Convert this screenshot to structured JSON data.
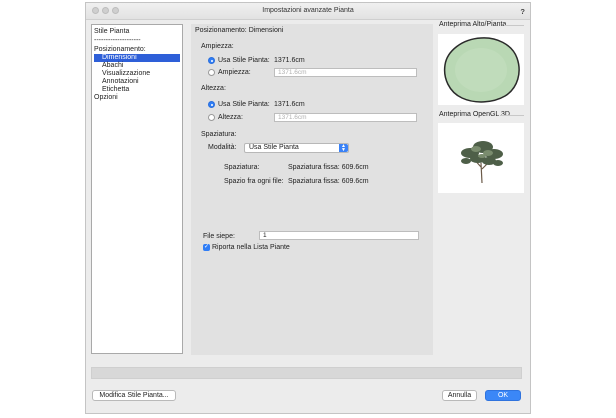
{
  "window": {
    "title": "Impostazioni avanzate Pianta",
    "help": "?"
  },
  "nav": {
    "items": [
      {
        "label": "Stile Pianta"
      },
      {
        "label": "--------------------"
      },
      {
        "label": "Posizionamento:"
      },
      {
        "label": "Dimensioni",
        "selected": true
      },
      {
        "label": "Abachi"
      },
      {
        "label": "Visualizzazione"
      },
      {
        "label": "Annotazioni"
      },
      {
        "label": "Etichetta"
      },
      {
        "label": "Opzioni"
      }
    ]
  },
  "main": {
    "header": "Posizionamento: Dimensioni",
    "ampiezza": {
      "section": "Ampiezza:",
      "use_style_label": "Usa Stile Pianta:",
      "use_style_value": "1371.6cm",
      "custom_label": "Ampiezza:",
      "custom_value": "1371.6cm"
    },
    "altezza": {
      "section": "Altezza:",
      "use_style_label": "Usa Stile Pianta:",
      "use_style_value": "1371.6cm",
      "custom_label": "Altezza:",
      "custom_value": "1371.6cm"
    },
    "spaziatura": {
      "section": "Spaziatura:",
      "mode_label": "Modalità:",
      "mode_value": "Usa Stile Pianta",
      "spacing_label": "Spaziatura:",
      "spacing_value": "Spaziatura fissa: 609.6cm",
      "row_spacing_label": "Spazio fra ogni file:",
      "row_spacing_value": "Spaziatura fissa: 609.6cm"
    },
    "file_siepe": {
      "label": "File siepe:",
      "value": "1"
    },
    "report_check": {
      "label": "Riporta nella Lista Piante",
      "checked": true
    }
  },
  "previews": {
    "top_label": "Anteprima Alto/Pianta",
    "opengl_label": "Anteprima OpenGL 3D",
    "canopy_color": "#b9d8b4"
  },
  "footer": {
    "edit_style_button": "Modifica Stile Pianta...",
    "cancel_button": "Annulla",
    "ok_button": "OK"
  },
  "colors": {
    "accent": "#2f7df6",
    "selection": "#2e5fd8"
  }
}
